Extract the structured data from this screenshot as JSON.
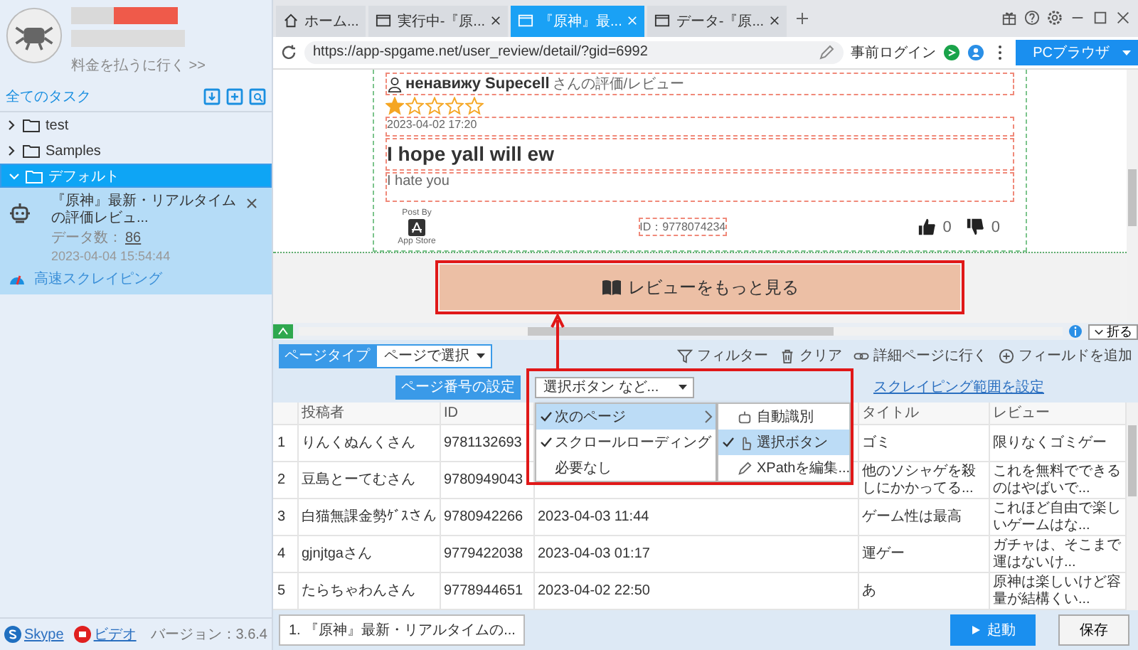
{
  "sidebar": {
    "account_link": "料金を払うに行く >>",
    "tasks_title": "全てのタスク",
    "tree": [
      {
        "label": "test",
        "expanded": false,
        "selected": false
      },
      {
        "label": "Samples",
        "expanded": false,
        "selected": false
      },
      {
        "label": "デフォルト",
        "expanded": true,
        "selected": true,
        "children": [
          {
            "title": "『原神』最新・リアルタイムの評価レビュ...",
            "count_label": "データ数：",
            "count": "86",
            "date": "2023-04-04 15:54:44",
            "mode": "高速スクレイピング"
          }
        ]
      }
    ],
    "links": [
      "Skype",
      "ビデオ"
    ],
    "version": "バージョン：3.6.4"
  },
  "browser": {
    "tabs": [
      {
        "label": "ホーム...",
        "kind": "home",
        "selected": false
      },
      {
        "label": "実行中-『原...",
        "kind": "page",
        "selected": false
      },
      {
        "label": "『原神』最...",
        "kind": "page",
        "selected": true
      },
      {
        "label": "データ-『原...",
        "kind": "page",
        "selected": false
      }
    ],
    "url": "https://app-spgame.net/user_review/detail/?gid=6992",
    "login": "事前ログイン",
    "mode_button": "PCブラウザ"
  },
  "review": {
    "user": "ненавижу Supecell",
    "user_suffix": "さんの評価/レビュー",
    "stars": 1,
    "date": "2023-04-02 17:20",
    "title": "I hope yall will ew",
    "body": "I hate you",
    "post_by": "Post By",
    "store": "App Store",
    "id": "ID：9778074234",
    "likes": "0",
    "dislikes": "0"
  },
  "more_button": "レビューをもっと見る",
  "collapse_button": "折る",
  "toolbar": {
    "page_type_label": "ページタイプ",
    "page_type_value": "ページで選択",
    "page_number_label": "ページ番号の設定",
    "page_number_value": "選択ボタン など...",
    "range_link": "スクレイピング範囲を設定",
    "tools": [
      {
        "label": "フィルター",
        "kind": "filter"
      },
      {
        "label": "クリア",
        "kind": "clear"
      },
      {
        "label": "詳細ページに行く",
        "kind": "link"
      },
      {
        "label": "フィールドを追加",
        "kind": "add"
      }
    ]
  },
  "menu": {
    "items": [
      {
        "label": "次のページ",
        "checked": true,
        "selected": true,
        "submenu": true
      },
      {
        "label": "スクロールローディング",
        "checked": true,
        "selected": false,
        "submenu": false
      },
      {
        "label": "必要なし",
        "checked": false,
        "selected": false,
        "submenu": false
      }
    ],
    "submenu": [
      {
        "label": "自動識別",
        "kind": "auto",
        "checked": false,
        "selected": false
      },
      {
        "label": "選択ボタン",
        "kind": "click",
        "checked": true,
        "selected": true
      },
      {
        "label": "XPathを編集...",
        "kind": "edit",
        "checked": false,
        "selected": false
      }
    ]
  },
  "table": {
    "columns": [
      "投稿者",
      "ID",
      null,
      "タイトル",
      "レビュー"
    ],
    "rows": [
      {
        "num": "1",
        "cells": [
          "りんくぬんくさん",
          "9781132693",
          null,
          "ゴミ",
          "限りなくゴミゲー"
        ]
      },
      {
        "num": "2",
        "cells": [
          "豆島とーてむさん",
          "9780949043",
          null,
          "他のソシャゲを殺しにかかってる...",
          "これを無料でできるのはやばいで..."
        ]
      },
      {
        "num": "3",
        "cells": [
          "白猫無課金勢ｹﾞｽさん",
          "9780942266",
          "2023-04-03 11:44",
          "ゲーム性は最高",
          "これほど自由で楽しいゲームはな..."
        ]
      },
      {
        "num": "4",
        "cells": [
          "gjnjtgaさん",
          "9779422038",
          "2023-04-03 01:17",
          "運ゲー",
          "ガチャは、そこまで運はないけ..."
        ]
      },
      {
        "num": "5",
        "cells": [
          "たらちゃわんさん",
          "9778944651",
          "2023-04-02 22:50",
          "あ",
          "原神は楽しいけど容量が結構くい..."
        ]
      }
    ]
  },
  "bottom": {
    "task_tab": "1. 『原神』最新・リアルタイムの...",
    "start_button": "起動",
    "save_button": "保存"
  }
}
